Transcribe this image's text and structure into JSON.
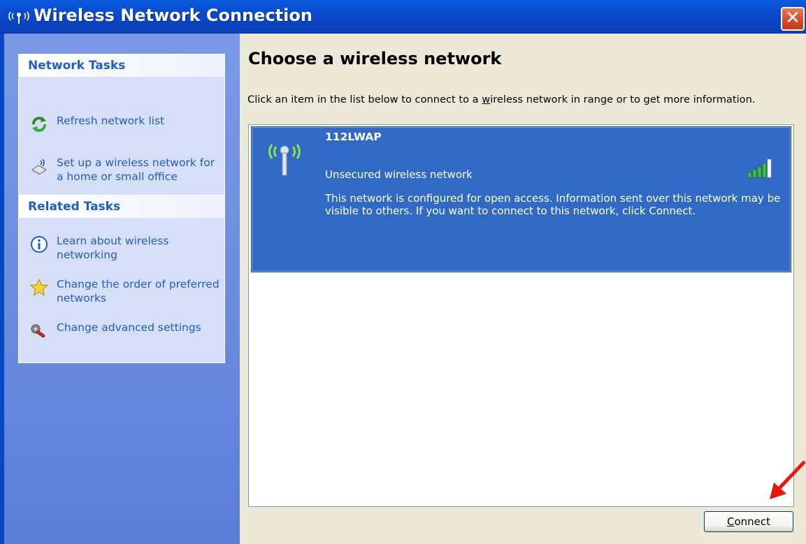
{
  "window": {
    "app_icon": "((·))",
    "title": "Wireless Network Connection",
    "close_label": "✕"
  },
  "network_tasks": {
    "header": "Network Tasks",
    "items": [
      {
        "label": "Refresh network list",
        "icon": "refresh-icon"
      },
      {
        "label": "Set up a wireless network for a home or small office",
        "icon": "wireless-setup-icon"
      }
    ]
  },
  "related_tasks": {
    "header": "Related Tasks",
    "items": [
      {
        "label": "Learn about wireless networking",
        "icon": "info-icon"
      },
      {
        "label": "Change the order of preferred networks",
        "icon": "star-icon"
      },
      {
        "label": "Change advanced settings",
        "icon": "settings-icon"
      }
    ]
  },
  "main": {
    "heading": "Choose a wireless network",
    "instruction_before": "Click an item in the list below to connect to a ",
    "instruction_underlined": "w",
    "instruction_after": "ireless network in range or to get more information."
  },
  "networks": [
    {
      "ssid": "112LWAP",
      "security": "Unsecured wireless network",
      "description": "This network is configured for open access. Information sent over this network may be visible to others. If you want to connect to this network, click Connect.",
      "signal_bars": 5,
      "selected": true
    }
  ],
  "buttons": {
    "connect_underlined": "C",
    "connect_rest": "onnect"
  },
  "colors": {
    "titlebar": "#0a4fd0",
    "taskpane": "#6f8fe0",
    "selection": "#316ac5",
    "arrow": "#e8170b"
  }
}
